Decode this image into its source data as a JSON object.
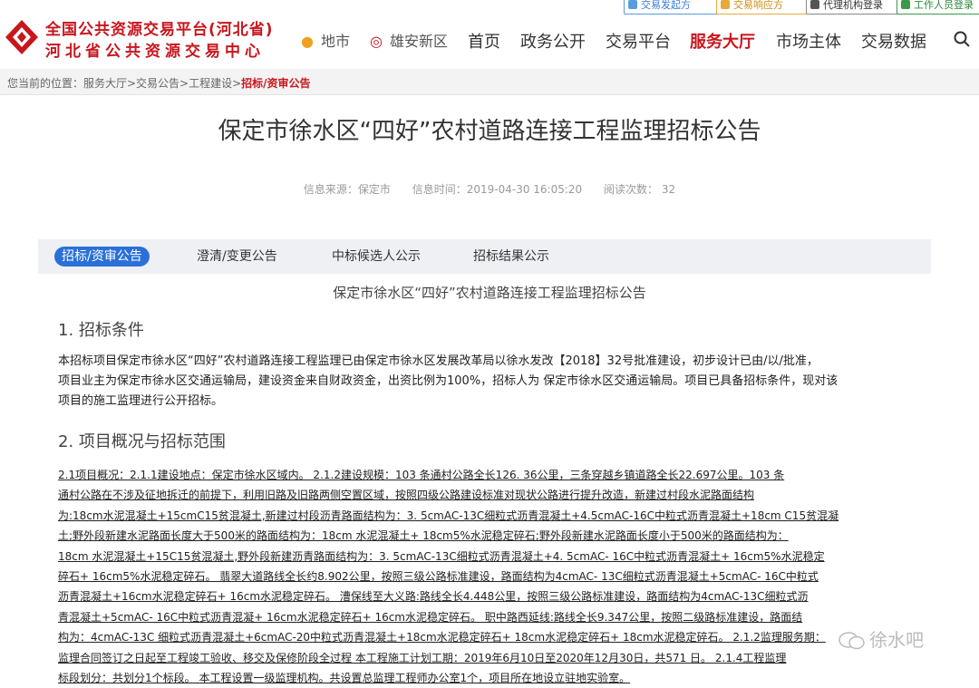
{
  "util_buttons": [
    "交易发起方",
    "交易响应方",
    "代理机构登录",
    "工作人员登录"
  ],
  "header": {
    "logo_line1": "全国公共资源交易平台(河北省)",
    "logo_line2": "河北省公共资源交易中心",
    "location1": "地市",
    "location2": "雄安新区",
    "nav": [
      "首页",
      "政务公开",
      "交易平台",
      "服务大厅",
      "市场主体",
      "交易数据"
    ],
    "active_nav": "服务大厅"
  },
  "breadcrumb": {
    "prefix": "您当前的位置：服务大厅>交易公告>工程建设>",
    "current": "招标/资审公告"
  },
  "article": {
    "title": "保定市徐水区“四好”农村道路连接工程监理招标公告",
    "source": "信息来源：保定市",
    "time": "信息时间：2019-04-30 16:05:20",
    "views": "阅读次数：    32"
  },
  "tabs": [
    "招标/资审公告",
    "澄清/变更公告",
    "中标候选人公示",
    "招标结果公示"
  ],
  "doc": {
    "title": "保定市徐水区“四好”农村道路连接工程监理招标公告",
    "section1": "1.  招标条件",
    "section1_lines": [
      "本招标项目保定市徐水区“四好”农村道路连接工程监理已由保定市徐水区发展改革局以徐水发改【2018】32号批准建设，初步设计已由/以/批准，",
      "项目业主为保定市徐水区交通运输局，建设资金来自财政资金，出资比例为100%，招标人为 保定市徐水区交通运输局。项目已具备招标条件，现对该",
      "项目的施工监理进行公开招标。"
    ],
    "section2": "2.  项目概况与招标范围",
    "section2_lines": [
      "2.1项目概况：2.1.1建设地点：保定市徐水区域内。 2.1.2建设规模：103 条通村公路全长126. 36公里，三条穿越乡镇道路全长22.697公里。103 条",
      "通村公路在不涉及征地拆迁的前提下，利用旧路及旧路两侧空置区域，按照四级公路建设标准对现状公路进行提升改造，新建过村段水泥路面结构",
      "为:18cm水泥混凝土+15cmC15贫混凝土,新建过村段沥青路面结构为：3. 5cmAC-13C细粒式沥青混凝土+4.5cmAC-16C中粒式沥青混凝土+18cm C15贫混凝",
      "土;野外段新建水泥路面长度大于500米的路面结构为：18cm 水泥混凝土+ 18cm5%水泥稳定碎石;野外段新建水泥路面长度小于500米的路面结构为：",
      "18cm 水泥混凝土+15C15贫混凝土,野外段新建沥青路面结构为：3. 5cmAC-13C细粒式沥青混凝土+4. 5cmAC- 16C中粒式沥青混凝土+ 16cm5%水泥稳定",
      "碎石+ 16cm5%水泥稳定碎石。  翡翠大道路线全长约8.902公里，按照三级公路标准建设，路面结构为4cmAC- 13C细粒式沥青混凝土+5cmAC- 16C中粒式",
      "沥青混凝土+16cm水泥稳定碎石+ 16cm水泥稳定碎石。  漕保线至大义路:路线全长4.448公里，按照三级公路标准建设，路面结构为4cmAC-13C细粒式沥",
      "青混凝土+5cmAC- 16C中粒式沥青混凝+ 16cm水泥稳定碎石+ 16cm水泥稳定碎石。  职中路西延线:路线全长9.347公里，按照二级路标准建设，路面结",
      "构为：4cmAC-13C 细粒式沥青混凝土+6cmAC-20中粒式沥青混凝土+18cm水泥稳定碎石+ 18cm水泥稳定碎石+ 18cm水泥稳定碎石。  2.1.2监理服务期：",
      "监理合同签订之日起至工程竣工验收、移交及保修阶段全过程 本工程施工计划工期：2019年6月10日至2020年12月30日，共571 日。 2.1.4工程监理",
      "标段划分：共划分1个标段。 本工程设置一级监理机构。共设置总监理工程师办公室1个，项目所在地设立驻地实验室。"
    ]
  },
  "watermark": "徐水吧",
  "colors": {
    "brand_red": "#c8161d",
    "tab_blue": "#2a70d8"
  }
}
